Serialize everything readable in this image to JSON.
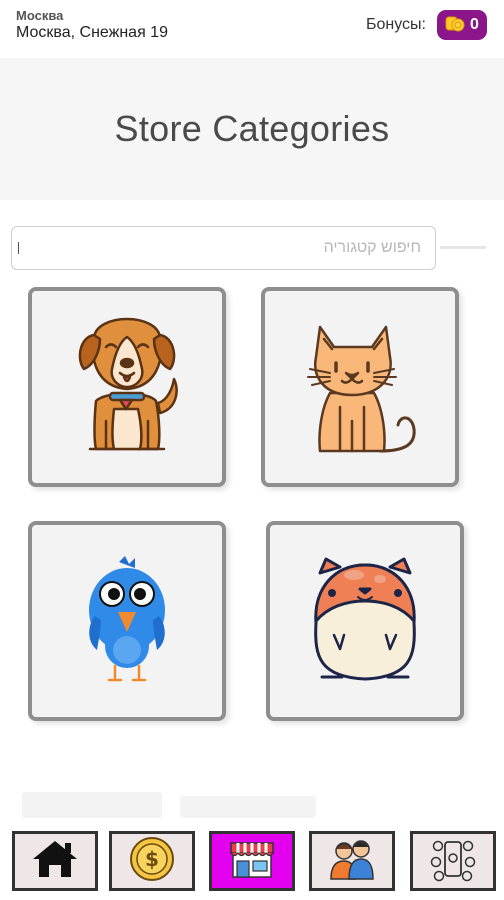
{
  "header": {
    "city": "Москва",
    "address": "Москва, Снежная 19",
    "bonus_label": "Бонусы:",
    "bonus_count": "0",
    "bonus_icon": "coins-icon",
    "accent_color": "#8a1689"
  },
  "banner": {
    "title": "Store Categories"
  },
  "search": {
    "placeholder": "חיפוש קטגוריה",
    "value": ""
  },
  "categories": [
    {
      "icon": "dog-icon"
    },
    {
      "icon": "cat-icon"
    },
    {
      "icon": "bird-icon"
    },
    {
      "icon": "hamster-icon"
    }
  ],
  "bottom_nav": {
    "active_color": "#e300ee",
    "items": [
      {
        "icon": "home-icon",
        "active": false
      },
      {
        "icon": "dollar-coin-icon",
        "active": false
      },
      {
        "icon": "store-icon",
        "active": true
      },
      {
        "icon": "community-icon",
        "active": false
      },
      {
        "icon": "social-media-icon",
        "active": false
      }
    ]
  }
}
